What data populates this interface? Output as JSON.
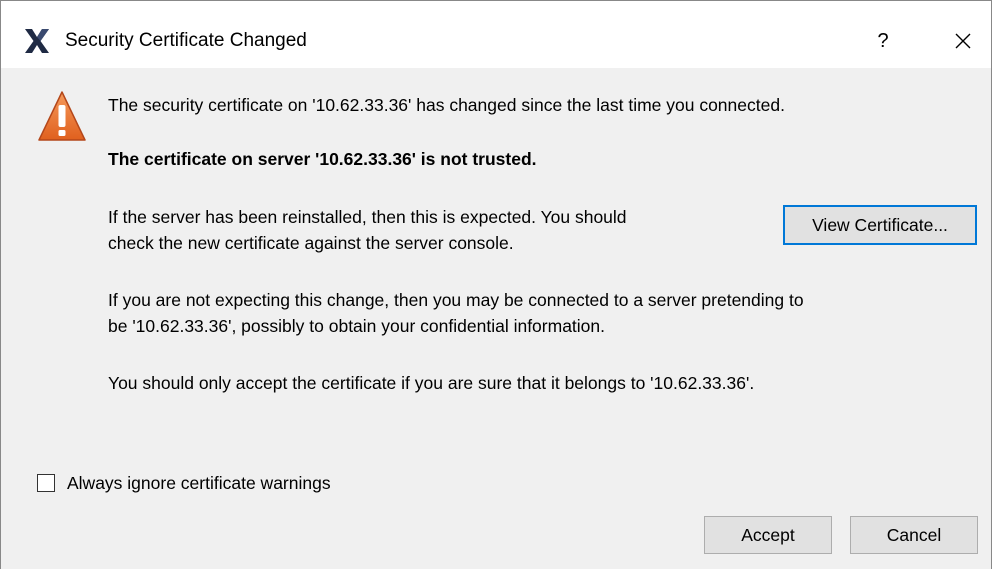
{
  "window": {
    "title": "Security Certificate Changed",
    "help_label": "?",
    "app_icon": "x-app-icon",
    "close_icon": "close-icon"
  },
  "message": {
    "icon": "warning-icon",
    "line1": "The security certificate on '10.62.33.36' has changed since the last time you connected.",
    "line2": "The certificate on server '10.62.33.36' is not trusted.",
    "para1_line1": "If the server has been reinstalled, then this is expected.  You should",
    "para1_line2": "check the new certificate against the server console.",
    "para2_line1": "If you are not expecting this change, then you may be connected to a server pretending to",
    "para2_line2": "be '10.62.33.36', possibly to obtain your confidential information.",
    "para3": "You should only accept the certificate if you are sure that it belongs to '10.62.33.36'."
  },
  "view_certificate_label": "View Certificate...",
  "ignore_warnings": {
    "label": "Always ignore certificate warnings",
    "checked": false
  },
  "buttons": {
    "accept_label": "Accept",
    "cancel_label": "Cancel"
  },
  "colors": {
    "focus_border": "#0078d7",
    "warning_fill": "#e8702a",
    "app_icon": "#1f2a44"
  }
}
